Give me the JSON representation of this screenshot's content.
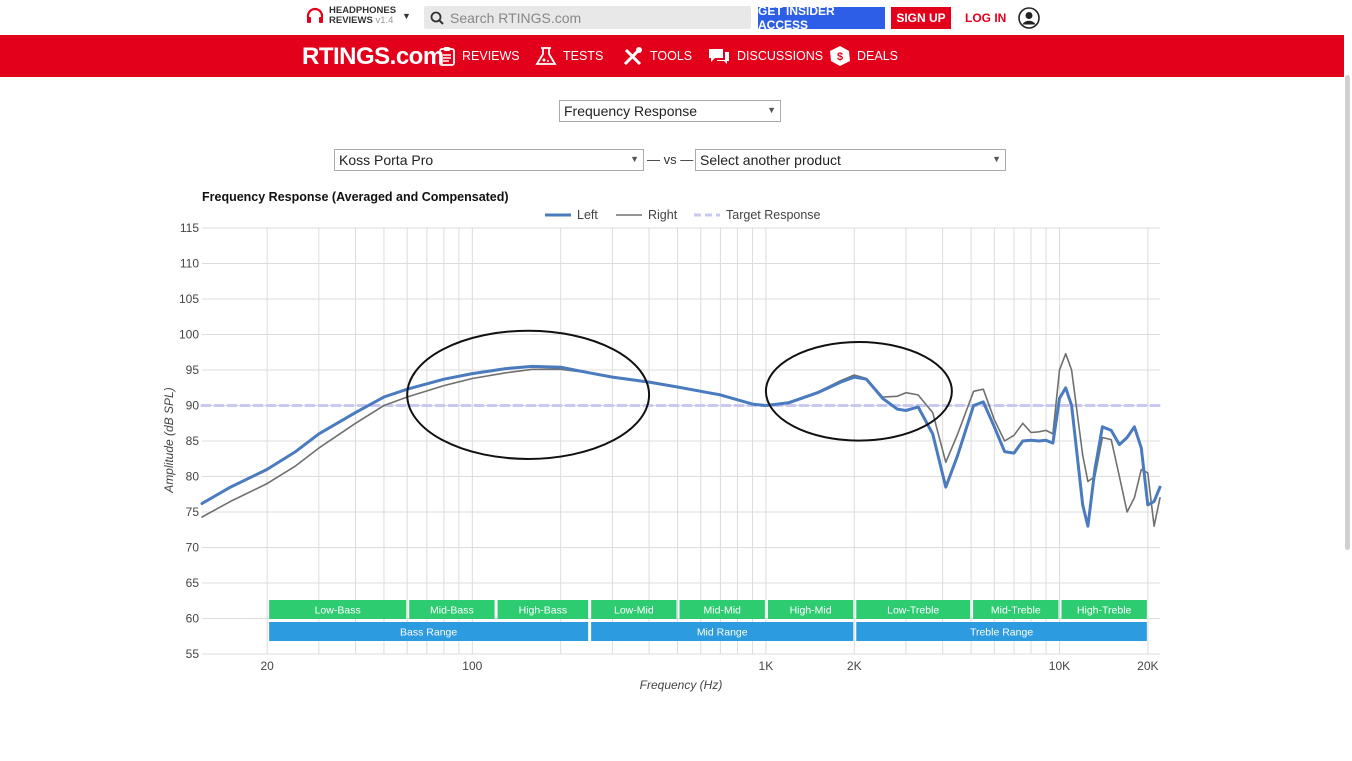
{
  "header": {
    "brand_line1": "HEADPHONES",
    "brand_line2": "REVIEWS",
    "brand_version": "v1.4",
    "search_placeholder": "Search RTINGS.com",
    "insider_label": "GET INSIDER ACCESS",
    "signup_label": "SIGN UP",
    "login_label": "LOG IN"
  },
  "nav": {
    "logo": "RTINGS.com",
    "items": [
      {
        "label": "REVIEWS",
        "icon": "clipboard-icon"
      },
      {
        "label": "TESTS",
        "icon": "flask-icon"
      },
      {
        "label": "TOOLS",
        "icon": "tools-icon"
      },
      {
        "label": "DISCUSSIONS",
        "icon": "chat-icon"
      },
      {
        "label": "DEALS",
        "icon": "tag-icon"
      }
    ]
  },
  "controls": {
    "test_select": "Frequency Response",
    "product_select": "Koss Porta Pro",
    "vs_label": "— vs —",
    "compare_select": "Select another product"
  },
  "colors": {
    "brand_red": "#e3001b",
    "insider_blue": "#2c5ee8",
    "left_series": "#4a7bbf",
    "right_series": "#707070",
    "target": "#c8c8f0",
    "range_green": "#2ecc71",
    "range_blue": "#2d9be0"
  },
  "chart_data": {
    "type": "line",
    "title": "Frequency Response (Averaged and Compensated)",
    "xlabel": "Frequency (Hz)",
    "ylabel": "Amplitude (dB SPL)",
    "x_scale": "log",
    "xlim": [
      12,
      22000
    ],
    "ylim": [
      55,
      115
    ],
    "yticks": [
      55,
      60,
      65,
      70,
      75,
      80,
      85,
      90,
      95,
      100,
      105,
      110,
      115
    ],
    "xtick_labels": [
      {
        "value": 20,
        "label": "20"
      },
      {
        "value": 100,
        "label": "100"
      },
      {
        "value": 1000,
        "label": "1K"
      },
      {
        "value": 2000,
        "label": "2K"
      },
      {
        "value": 10000,
        "label": "10K"
      },
      {
        "value": 20000,
        "label": "20K"
      }
    ],
    "grid": true,
    "legend_position": "top",
    "series": [
      {
        "name": "Left",
        "points": [
          [
            12,
            76.2
          ],
          [
            15,
            78.5
          ],
          [
            20,
            81
          ],
          [
            25,
            83.5
          ],
          [
            30,
            86
          ],
          [
            40,
            89
          ],
          [
            50,
            91.2
          ],
          [
            60,
            92.3
          ],
          [
            80,
            93.7
          ],
          [
            100,
            94.5
          ],
          [
            130,
            95.2
          ],
          [
            160,
            95.5
          ],
          [
            200,
            95.4
          ],
          [
            250,
            94.6
          ],
          [
            300,
            94
          ],
          [
            400,
            93.3
          ],
          [
            500,
            92.6
          ],
          [
            600,
            92
          ],
          [
            700,
            91.5
          ],
          [
            800,
            90.8
          ],
          [
            900,
            90.2
          ],
          [
            1000,
            90
          ],
          [
            1200,
            90.4
          ],
          [
            1500,
            91.8
          ],
          [
            1800,
            93.3
          ],
          [
            2000,
            94
          ],
          [
            2200,
            93.7
          ],
          [
            2500,
            91
          ],
          [
            2800,
            89.5
          ],
          [
            3000,
            89.3
          ],
          [
            3300,
            89.8
          ],
          [
            3700,
            86
          ],
          [
            4100,
            78.5
          ],
          [
            4500,
            83
          ],
          [
            5100,
            90
          ],
          [
            5500,
            90.5
          ],
          [
            6000,
            87
          ],
          [
            6500,
            83.5
          ],
          [
            7000,
            83.3
          ],
          [
            7500,
            85
          ],
          [
            8000,
            85.1
          ],
          [
            8500,
            85
          ],
          [
            9000,
            85.1
          ],
          [
            9500,
            84.7
          ],
          [
            10000,
            91
          ],
          [
            10500,
            92.5
          ],
          [
            11000,
            90
          ],
          [
            12000,
            76
          ],
          [
            12500,
            73
          ],
          [
            13200,
            81
          ],
          [
            14000,
            87
          ],
          [
            15000,
            86.5
          ],
          [
            16000,
            84.5
          ],
          [
            17000,
            85.5
          ],
          [
            18000,
            87
          ],
          [
            19000,
            84
          ],
          [
            20000,
            76
          ],
          [
            21000,
            76.5
          ],
          [
            22000,
            78.5
          ]
        ]
      },
      {
        "name": "Right",
        "points": [
          [
            12,
            74.3
          ],
          [
            15,
            76.5
          ],
          [
            20,
            79
          ],
          [
            25,
            81.5
          ],
          [
            30,
            84
          ],
          [
            40,
            87.5
          ],
          [
            50,
            90
          ],
          [
            60,
            91.2
          ],
          [
            80,
            92.8
          ],
          [
            100,
            93.8
          ],
          [
            130,
            94.6
          ],
          [
            160,
            95.1
          ],
          [
            200,
            95.1
          ],
          [
            250,
            94.6
          ],
          [
            300,
            94
          ],
          [
            400,
            93.3
          ],
          [
            500,
            92.6
          ],
          [
            600,
            92
          ],
          [
            700,
            91.5
          ],
          [
            800,
            90.8
          ],
          [
            900,
            90.2
          ],
          [
            1000,
            90
          ],
          [
            1200,
            90.5
          ],
          [
            1500,
            91.9
          ],
          [
            1800,
            93.5
          ],
          [
            2000,
            94.3
          ],
          [
            2200,
            93.8
          ],
          [
            2500,
            91.2
          ],
          [
            2800,
            91.3
          ],
          [
            3000,
            91.8
          ],
          [
            3300,
            91.5
          ],
          [
            3700,
            89
          ],
          [
            4100,
            82
          ],
          [
            4500,
            86
          ],
          [
            5100,
            92
          ],
          [
            5500,
            92.3
          ],
          [
            6000,
            88
          ],
          [
            6500,
            85
          ],
          [
            7000,
            85.8
          ],
          [
            7500,
            87.5
          ],
          [
            8000,
            86.2
          ],
          [
            8500,
            86.3
          ],
          [
            9000,
            86.5
          ],
          [
            9500,
            86
          ],
          [
            10000,
            95
          ],
          [
            10500,
            97.3
          ],
          [
            11000,
            95
          ],
          [
            12000,
            83
          ],
          [
            12500,
            79.3
          ],
          [
            13200,
            80
          ],
          [
            14000,
            85.5
          ],
          [
            15000,
            85.2
          ],
          [
            16000,
            80
          ],
          [
            17000,
            75
          ],
          [
            18000,
            77
          ],
          [
            19000,
            81
          ],
          [
            20000,
            80.5
          ],
          [
            21000,
            73
          ],
          [
            22000,
            77
          ]
        ]
      },
      {
        "name": "Target Response",
        "points": [
          [
            12,
            90
          ],
          [
            22000,
            90
          ]
        ]
      }
    ],
    "range_bands": {
      "row1": [
        {
          "label": "Low-Bass",
          "from": 20,
          "to": 60
        },
        {
          "label": "Mid-Bass",
          "from": 60,
          "to": 120
        },
        {
          "label": "High-Bass",
          "from": 120,
          "to": 250
        },
        {
          "label": "Low-Mid",
          "from": 250,
          "to": 500
        },
        {
          "label": "Mid-Mid",
          "from": 500,
          "to": 1000
        },
        {
          "label": "High-Mid",
          "from": 1000,
          "to": 2000
        },
        {
          "label": "Low-Treble",
          "from": 2000,
          "to": 5000
        },
        {
          "label": "Mid-Treble",
          "from": 5000,
          "to": 10000
        },
        {
          "label": "High-Treble",
          "from": 10000,
          "to": 20000
        }
      ],
      "row2": [
        {
          "label": "Bass Range",
          "from": 20,
          "to": 250
        },
        {
          "label": "Mid Range",
          "from": 250,
          "to": 2000
        },
        {
          "label": "Treble Range",
          "from": 2000,
          "to": 20000
        }
      ]
    },
    "annotations": [
      {
        "shape": "ellipse",
        "from": 60,
        "to": 400,
        "y_center": 91.5
      },
      {
        "shape": "ellipse",
        "from": 1000,
        "to": 4300,
        "y_center": 92
      }
    ]
  }
}
